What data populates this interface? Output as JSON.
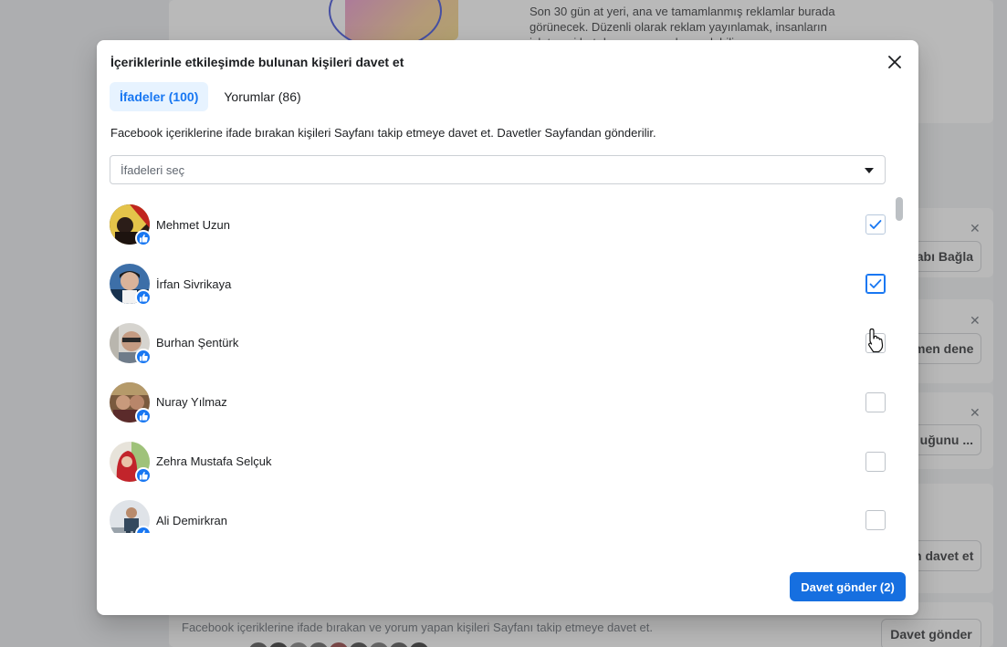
{
  "background": {
    "top_text": [
      "Son 30 gün at yeri, ana ve tamamlanmış reklamlar burada",
      "görünecek. Düzenli olarak reklam yayınlamak, insanların",
      "işletmeni hatırlamasına yardımcı olabilir."
    ],
    "side_buttons": [
      {
        "label": "abı Bağla"
      },
      {
        "label": "men dene"
      },
      {
        "label": "uğunu ..."
      },
      {
        "label": "n davet et"
      }
    ],
    "bottom_text": "Facebook içeriklerine ifade bırakan ve yorum yapan kişileri Sayfanı takip etmeye davet et.",
    "bottom_button": "Davet gönder"
  },
  "modal": {
    "title": "İçeriklerinle etkileşimde bulunan kişileri davet et",
    "tabs": [
      {
        "label": "İfadeler (100)",
        "active": true
      },
      {
        "label": "Yorumlar (86)",
        "active": false
      }
    ],
    "description": "Facebook içeriklerine ifade bırakan kişileri Sayfanı takip etmeye davet et. Davetler Sayfandan gönderilir.",
    "select_placeholder": "İfadeleri seç",
    "people": [
      {
        "name": "Mehmet Uzun",
        "checked": true
      },
      {
        "name": "İrfan Sivrikaya",
        "checked": true
      },
      {
        "name": "Burhan Şentürk",
        "checked": false
      },
      {
        "name": "Nuray Yılmaz",
        "checked": false
      },
      {
        "name": "Zehra Mustafa Selçuk",
        "checked": false
      },
      {
        "name": "Ali Demirkran",
        "checked": false
      }
    ],
    "send_button": "Davet gönder (2)"
  },
  "colors": {
    "accent": "#1877f2",
    "tab_active_bg": "#e7f3ff",
    "send_button": "#166fe0"
  },
  "icons": {
    "close": "close-icon",
    "dropdown": "caret-down-icon",
    "reaction": "like-icon",
    "check": "checkmark-icon",
    "cursor": "hand-pointer-icon"
  }
}
